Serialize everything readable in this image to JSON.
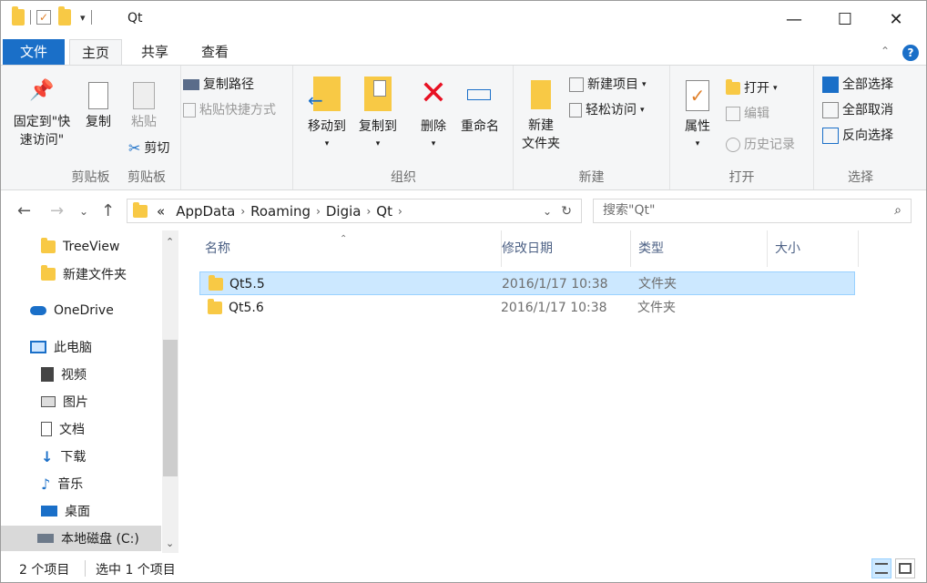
{
  "window": {
    "title": "Qt",
    "controls": {
      "minimize": "—",
      "maximize": "☐",
      "close": "✕"
    }
  },
  "tabs": [
    {
      "label": "文件"
    },
    {
      "label": "主页"
    },
    {
      "label": "共享"
    },
    {
      "label": "查看"
    }
  ],
  "ribbon": {
    "clipboard": {
      "group_label": "剪贴板",
      "pin_label": "固定到\"快速访问\"",
      "pin_line1": "固定到\"快",
      "pin_line2": "速访问\"",
      "copy_label": "复制",
      "paste_label": "粘贴",
      "copy_path_label": "复制路径",
      "paste_shortcut_label": "粘贴快捷方式",
      "cut_label": "剪切"
    },
    "organize": {
      "group_label": "组织",
      "move_to_label": "移动到",
      "copy_to_label": "复制到",
      "delete_label": "删除",
      "rename_label": "重命名"
    },
    "new": {
      "group_label": "新建",
      "new_folder_line1": "新建",
      "new_folder_line2": "文件夹",
      "new_item_label": "新建项目",
      "easy_access_label": "轻松访问"
    },
    "open": {
      "group_label": "打开",
      "properties_label": "属性",
      "open_label": "打开",
      "edit_label": "编辑",
      "history_label": "历史记录"
    },
    "select": {
      "group_label": "选择",
      "select_all_label": "全部选择",
      "select_none_label": "全部取消",
      "invert_label": "反向选择"
    }
  },
  "address": {
    "overflow": "«",
    "crumbs": [
      "AppData",
      "Roaming",
      "Digia",
      "Qt"
    ],
    "search_placeholder": "搜索\"Qt\""
  },
  "navpane": {
    "items": [
      {
        "label": "TreeView",
        "icon": "folder-icon"
      },
      {
        "label": "新建文件夹",
        "icon": "folder-icon"
      },
      {
        "label": "OneDrive",
        "icon": "cloud-icon"
      },
      {
        "label": "此电脑",
        "icon": "computer-icon"
      },
      {
        "label": "视频",
        "icon": "video-icon"
      },
      {
        "label": "图片",
        "icon": "picture-icon"
      },
      {
        "label": "文档",
        "icon": "document-icon"
      },
      {
        "label": "下载",
        "icon": "download-icon"
      },
      {
        "label": "音乐",
        "icon": "music-icon"
      },
      {
        "label": "桌面",
        "icon": "desktop-icon"
      },
      {
        "label": "本地磁盘 (C:)",
        "icon": "drive-icon"
      }
    ]
  },
  "filelist": {
    "columns": [
      "名称",
      "修改日期",
      "类型",
      "大小"
    ],
    "rows": [
      {
        "name": "Qt5.5",
        "modified": "2016/1/17 10:38",
        "type": "文件夹",
        "size": ""
      },
      {
        "name": "Qt5.6",
        "modified": "2016/1/17 10:38",
        "type": "文件夹",
        "size": ""
      }
    ]
  },
  "status": {
    "item_count": "2 个项目",
    "selected": "选中 1 个项目"
  },
  "colors": {
    "file_tab": "#1a6fc8",
    "selection": "#cce8ff",
    "selection_border": "#99d1ff",
    "folder": "#f8c945",
    "delete_red": "#e81123",
    "help_blue": "#1a6fc8"
  }
}
